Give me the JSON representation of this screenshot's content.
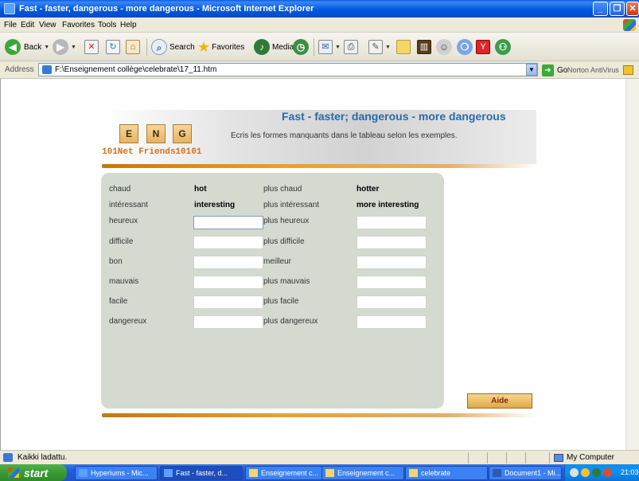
{
  "window": {
    "title": "Fast - faster, dangerous - more dangerous - Microsoft Internet Explorer"
  },
  "menu": [
    "File",
    "Edit",
    "View",
    "Favorites",
    "Tools",
    "Help"
  ],
  "toolbar": {
    "back": "Back",
    "search": "Search",
    "favorites": "Favorites",
    "media": "Media"
  },
  "address": {
    "label": "Address",
    "url": "F:\\Enseignement collège\\celebrate\\17_11.htm",
    "go": "Go",
    "norton": "Norton AntiVirus"
  },
  "page": {
    "brand_letters": [
      "E",
      "N",
      "G"
    ],
    "brand_tagline": "101Net Friends10101",
    "title": "Fast - faster; dangerous - more dangerous",
    "instruction": "Ecris les formes manquants dans le tableau selon les exemples.",
    "examples": [
      {
        "fr": "chaud",
        "en": "hot",
        "fr_comp": "plus chaud",
        "en_comp": "hotter"
      },
      {
        "fr": "intéressant",
        "en": "interesting",
        "fr_comp": "plus intéressant",
        "en_comp": "more interesting"
      }
    ],
    "rows": [
      {
        "fr": "heureux",
        "fr_comp": "plus heureux",
        "answer1": "",
        "answer2": ""
      },
      {
        "fr": "difficile",
        "fr_comp": "plus difficile",
        "answer1": "",
        "answer2": ""
      },
      {
        "fr": "bon",
        "fr_comp": "meilleur",
        "answer1": "",
        "answer2": ""
      },
      {
        "fr": "mauvais",
        "fr_comp": "plus mauvais",
        "answer1": "",
        "answer2": ""
      },
      {
        "fr": "facile",
        "fr_comp": "plus facile",
        "answer1": "",
        "answer2": ""
      },
      {
        "fr": "dangereux",
        "fr_comp": "plus dangereux",
        "answer1": "",
        "answer2": ""
      }
    ],
    "help_button": "Aide"
  },
  "status": {
    "text": "Kaikki ladattu.",
    "zone": "My Computer"
  },
  "taskbar": {
    "start": "start",
    "tasks": [
      "Hyperiums - Mic...",
      "Fast - faster, d...",
      "Enseignement c...",
      "Enseignement c...",
      "celebrate",
      "Document1 - Mi..."
    ],
    "clock": "21:03"
  },
  "colors": {
    "title_blue": "#2a6aa8",
    "panel_bg": "#d5dad1",
    "accent_orange": "#e8a02a"
  }
}
